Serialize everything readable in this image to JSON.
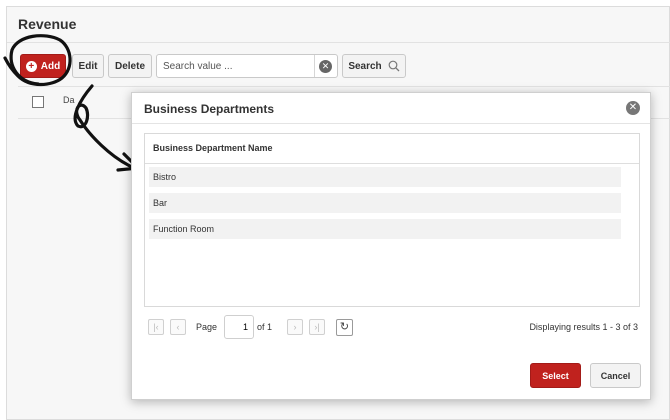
{
  "page": {
    "title": "Revenue"
  },
  "toolbar": {
    "add_label": "Add",
    "edit_label": "Edit",
    "delete_label": "Delete",
    "search_placeholder": "Search value ...",
    "search_label": "Search"
  },
  "grid": {
    "first_column_peek": "Da"
  },
  "modal": {
    "title": "Business Departments",
    "column_header": "Business Department Name",
    "items": [
      {
        "label": "Bistro"
      },
      {
        "label": "Bar"
      },
      {
        "label": "Function Room"
      }
    ],
    "pager": {
      "page_label": "Page",
      "page_value": "1",
      "of_label": "of 1",
      "results_text": "Displaying results 1 - 3 of 3"
    },
    "select_label": "Select",
    "cancel_label": "Cancel"
  },
  "icons": {
    "add": "plus-circle-icon",
    "clear": "clear-circle-icon",
    "search": "magnifier-icon",
    "close": "close-circle-icon",
    "refresh": "refresh-icon",
    "pager_first": "first-page-icon",
    "pager_prev": "prev-page-icon",
    "pager_next": "next-page-icon",
    "pager_last": "last-page-icon"
  },
  "colors": {
    "accent": "#c0221e",
    "annotation_ink": "#111111"
  }
}
